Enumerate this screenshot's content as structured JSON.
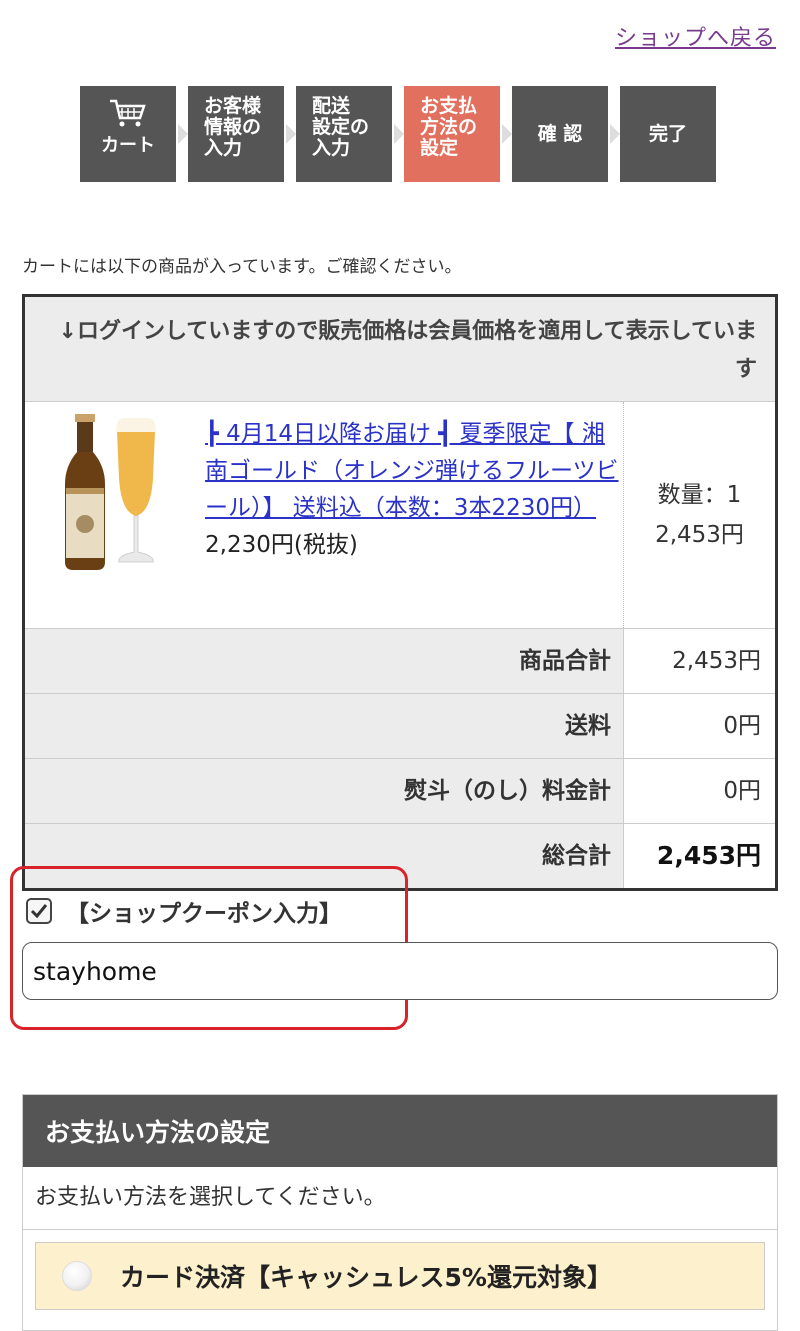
{
  "header": {
    "back_link": "ショップへ戻る"
  },
  "steps": [
    {
      "label": "カート",
      "active": false
    },
    {
      "label": "お客様\n情報の\n入力",
      "active": false
    },
    {
      "label": "配送\n設定の\n入力",
      "active": false
    },
    {
      "label": "お支払\n方法の\n設定",
      "active": true
    },
    {
      "label": "確 認",
      "active": false
    },
    {
      "label": "完了",
      "active": false
    }
  ],
  "intro": "カートには以下の商品が入っています。ご確認ください。",
  "cart": {
    "notice": "↓ログインしていますので販売価格は会員価格を適用して表示しています",
    "item": {
      "title": "┣ 4月14日以降お届け ┫ 夏季限定【 湘南ゴールド（オレンジ弾けるフルーツビール）】 送料込（本数：3本2230円）",
      "price": "2,230円(税抜)",
      "qty": "数量：1",
      "total": "2,453円"
    },
    "summary": [
      {
        "label": "商品合計",
        "value": "2,453円"
      },
      {
        "label": "送料",
        "value": "0円"
      },
      {
        "label": "熨斗（のし）料金計",
        "value": "0円"
      },
      {
        "label": "総合計",
        "value": "2,453円"
      }
    ]
  },
  "coupon": {
    "label": "【ショップクーポン入力】",
    "value": "stayhome",
    "checked": true
  },
  "payment": {
    "header": "お支払い方法の設定",
    "instruction": "お支払い方法を選択してください。",
    "option": "カード決済【キャッシュレス5%還元対象】"
  },
  "colors": {
    "step_active": "#e2705f",
    "step_default": "#555555",
    "link": "#2a32c8",
    "highlight": "#d8232a"
  }
}
